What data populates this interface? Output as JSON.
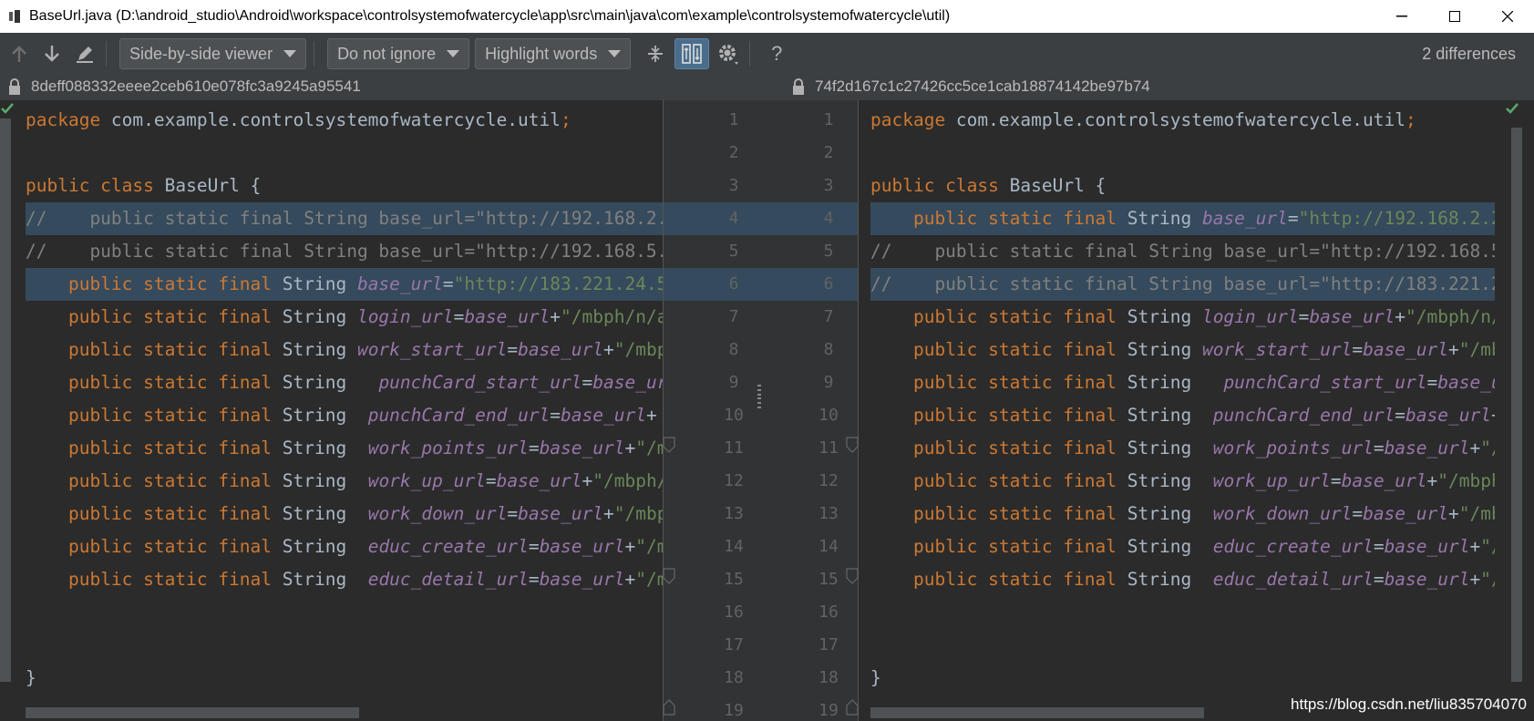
{
  "window": {
    "title": "BaseUrl.java (D:\\android_studio\\Android\\workspace\\controlsystemofwatercycle\\app\\src\\main\\java\\com\\example\\controlsystemofwatercycle\\util)"
  },
  "toolbar": {
    "viewer_mode": "Side-by-side viewer",
    "ignore_mode": "Do not ignore",
    "highlight_mode": "Highlight words",
    "diff_count": "2 differences",
    "help_label": "?"
  },
  "left": {
    "hash": "8deff088332eeee2ceb610e078fc3a9245a95541"
  },
  "right": {
    "hash": "74f2d167c1c27426cc5ce1cab18874142be97b74"
  },
  "line_numbers": [
    "1",
    "2",
    "3",
    "4",
    "5",
    "6",
    "7",
    "8",
    "9",
    "10",
    "11",
    "12",
    "13",
    "14",
    "15",
    "16",
    "17",
    "18",
    "19"
  ],
  "changed_lines": {
    "left": [
      4,
      6
    ],
    "right": [
      4,
      6
    ]
  },
  "watermark": "https://blog.csdn.net/liu835704070",
  "colors": {
    "keyword": "#cc7832",
    "field": "#9876aa",
    "string": "#6a8759",
    "comment": "#808080",
    "changed_bg": "#354a5c",
    "check": "#59a869"
  }
}
